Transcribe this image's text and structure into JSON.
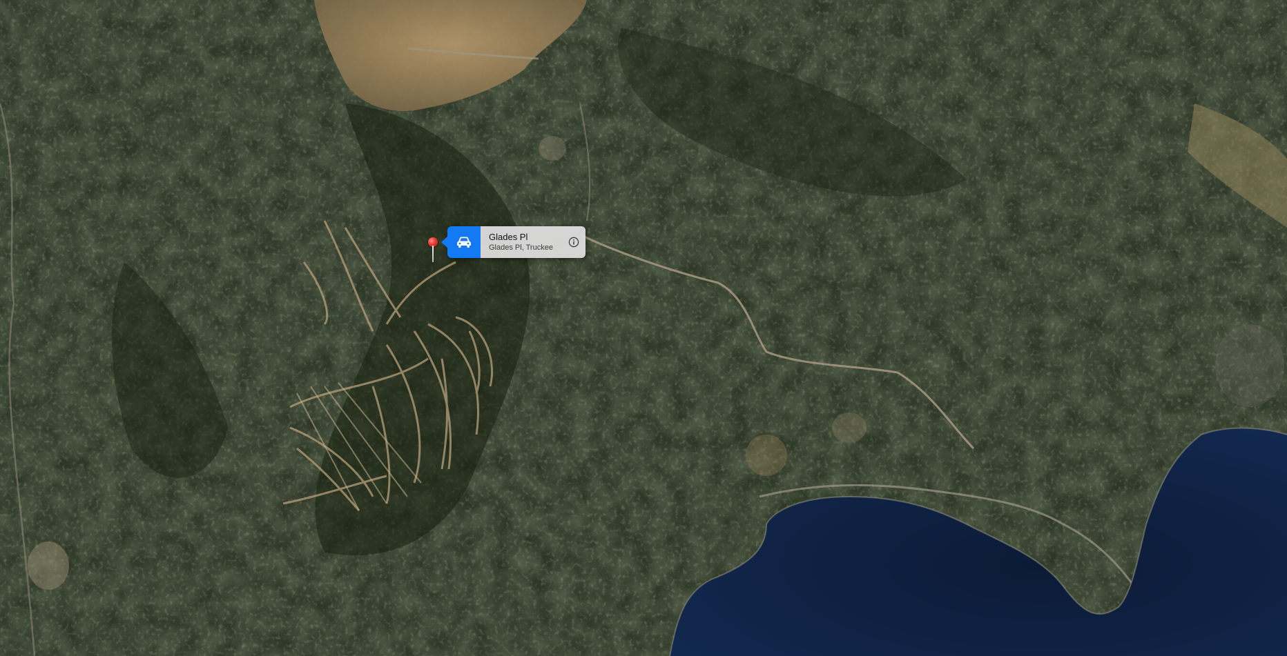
{
  "map": {
    "view": "satellite",
    "colors": {
      "forest": "#2b3524",
      "forest_dark": "#1c2417",
      "dry_hills": "#a58a62",
      "lake": "#0e1e3c",
      "road": "#a89a82",
      "pin": "#e53935",
      "accent": "#1479f5"
    }
  },
  "pin": {
    "icon": "map-pin-icon"
  },
  "callout": {
    "action_icon": "car-icon",
    "title": "Glades Pl",
    "subtitle": "Glades Pl, Truckee",
    "info_icon": "info-circle-icon"
  }
}
